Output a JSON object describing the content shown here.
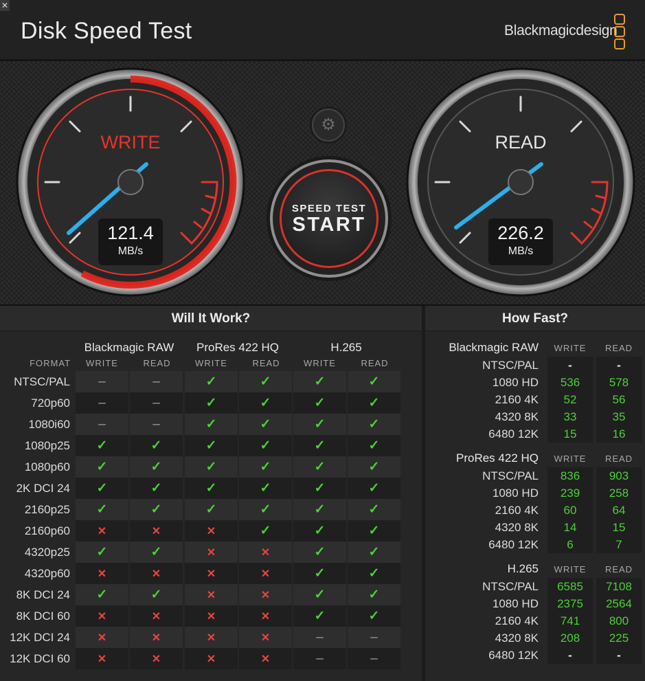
{
  "window": {
    "close_label": "✕",
    "title": "Disk Speed Test",
    "brand": "Blackmagicdesign"
  },
  "gauges": {
    "write": {
      "label": "WRITE",
      "value": "121.4",
      "unit": "MB/s",
      "label_color": "#e8332a"
    },
    "read": {
      "label": "READ",
      "value": "226.2",
      "unit": "MB/s",
      "label_color": "#e6e6e6"
    }
  },
  "controls": {
    "settings_icon": "gear-icon",
    "start_small": "SPEED TEST",
    "start_big": "START"
  },
  "will_it_work": {
    "heading": "Will It Work?",
    "format_header": "FORMAT",
    "groups": [
      "Blackmagic RAW",
      "ProRes 422 HQ",
      "H.265"
    ],
    "sub_headers": [
      "WRITE",
      "READ"
    ],
    "rows": [
      {
        "format": "NTSC/PAL",
        "cells": [
          "na",
          "na",
          "ok",
          "ok",
          "ok",
          "ok"
        ]
      },
      {
        "format": "720p60",
        "cells": [
          "na",
          "na",
          "ok",
          "ok",
          "ok",
          "ok"
        ]
      },
      {
        "format": "1080i60",
        "cells": [
          "na",
          "na",
          "ok",
          "ok",
          "ok",
          "ok"
        ]
      },
      {
        "format": "1080p25",
        "cells": [
          "ok",
          "ok",
          "ok",
          "ok",
          "ok",
          "ok"
        ]
      },
      {
        "format": "1080p60",
        "cells": [
          "ok",
          "ok",
          "ok",
          "ok",
          "ok",
          "ok"
        ]
      },
      {
        "format": "2K DCI 24",
        "cells": [
          "ok",
          "ok",
          "ok",
          "ok",
          "ok",
          "ok"
        ]
      },
      {
        "format": "2160p25",
        "cells": [
          "ok",
          "ok",
          "ok",
          "ok",
          "ok",
          "ok"
        ]
      },
      {
        "format": "2160p60",
        "cells": [
          "no",
          "no",
          "no",
          "ok",
          "ok",
          "ok"
        ]
      },
      {
        "format": "4320p25",
        "cells": [
          "ok",
          "ok",
          "no",
          "no",
          "ok",
          "ok"
        ]
      },
      {
        "format": "4320p60",
        "cells": [
          "no",
          "no",
          "no",
          "no",
          "ok",
          "ok"
        ]
      },
      {
        "format": "8K DCI 24",
        "cells": [
          "ok",
          "ok",
          "no",
          "no",
          "ok",
          "ok"
        ]
      },
      {
        "format": "8K DCI 60",
        "cells": [
          "no",
          "no",
          "no",
          "no",
          "ok",
          "ok"
        ]
      },
      {
        "format": "12K DCI 24",
        "cells": [
          "no",
          "no",
          "no",
          "no",
          "na",
          "na"
        ]
      },
      {
        "format": "12K DCI 60",
        "cells": [
          "no",
          "no",
          "no",
          "no",
          "na",
          "na"
        ]
      }
    ],
    "symbols": {
      "ok": "✓",
      "no": "✕",
      "na": "–"
    }
  },
  "how_fast": {
    "heading": "How Fast?",
    "col_write": "WRITE",
    "col_read": "READ",
    "groups": [
      {
        "name": "Blackmagic RAW",
        "rows": [
          {
            "format": "NTSC/PAL",
            "write": "-",
            "read": "-"
          },
          {
            "format": "1080 HD",
            "write": "536",
            "read": "578"
          },
          {
            "format": "2160 4K",
            "write": "52",
            "read": "56"
          },
          {
            "format": "4320 8K",
            "write": "33",
            "read": "35"
          },
          {
            "format": "6480 12K",
            "write": "15",
            "read": "16"
          }
        ]
      },
      {
        "name": "ProRes 422 HQ",
        "rows": [
          {
            "format": "NTSC/PAL",
            "write": "836",
            "read": "903"
          },
          {
            "format": "1080 HD",
            "write": "239",
            "read": "258"
          },
          {
            "format": "2160 4K",
            "write": "60",
            "read": "64"
          },
          {
            "format": "4320 8K",
            "write": "14",
            "read": "15"
          },
          {
            "format": "6480 12K",
            "write": "6",
            "read": "7"
          }
        ]
      },
      {
        "name": "H.265",
        "rows": [
          {
            "format": "NTSC/PAL",
            "write": "6585",
            "read": "7108"
          },
          {
            "format": "1080 HD",
            "write": "2375",
            "read": "2564"
          },
          {
            "format": "2160 4K",
            "write": "741",
            "read": "800"
          },
          {
            "format": "4320 8K",
            "write": "208",
            "read": "225"
          },
          {
            "format": "6480 12K",
            "write": "-",
            "read": "-"
          }
        ]
      }
    ]
  }
}
